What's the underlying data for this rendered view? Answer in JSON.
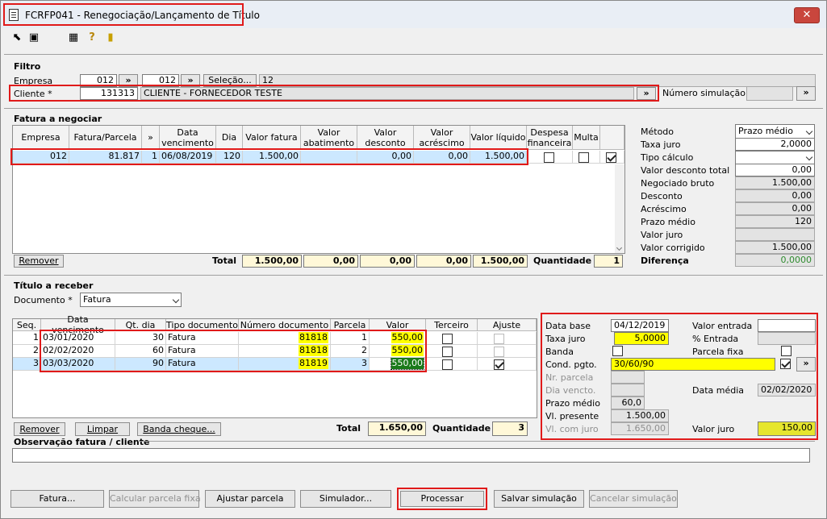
{
  "window": {
    "title": "FCRFP041 - Renegociação/Lançamento de Título",
    "close": "✕"
  },
  "toolbar": {
    "icons": [
      "cursor-arrow-icon",
      "copy-window-icon",
      "grid-icon",
      "help-icon",
      "exit-door-icon"
    ]
  },
  "filtro": {
    "legend": "Filtro",
    "empresa_label": "Empresa",
    "empresa_from": "012",
    "empresa_to": "012",
    "lookup": "»",
    "selecao_label": "Seleção...",
    "selecao_value": "12",
    "cliente_label": "Cliente *",
    "cliente_code": "131313",
    "cliente_name": "CLIENTE - FORNECEDOR TESTE",
    "numero_sim_label": "Número simulação",
    "numero_sim_value": ""
  },
  "fatura": {
    "legend": "Fatura a negociar",
    "headers": [
      "Empresa",
      "Fatura/Parcela",
      "»",
      "Data vencimento",
      "Dia",
      "Valor fatura",
      "Valor abatimento",
      "Valor desconto",
      "Valor acréscimo",
      "Valor líquido",
      "Despesa financeira",
      "Multa",
      ""
    ],
    "row": [
      "012",
      "81.817",
      "1",
      "06/08/2019",
      "120",
      "1.500,00",
      "",
      "0,00",
      "0,00",
      "1.500,00"
    ],
    "remover": "Remover",
    "total_label": "Total",
    "totals": [
      "1.500,00",
      "0,00",
      "0,00",
      "0,00",
      "1.500,00"
    ],
    "quantidade_label": "Quantidade",
    "quantidade": "1"
  },
  "metodo": {
    "metodo_label": "Método",
    "metodo_value": "Prazo médio",
    "taxa_juro_label": "Taxa juro",
    "taxa_juro": "2,0000",
    "tipo_calculo_label": "Tipo cálculo",
    "tipo_calculo": "",
    "valor_desc_total_label": "Valor desconto total",
    "valor_desc_total": "0,00",
    "negociado_bruto_label": "Negociado bruto",
    "negociado_bruto": "1.500,00",
    "desconto_label": "Desconto",
    "desconto": "0,00",
    "acrescimo_label": "Acréscimo",
    "acrescimo": "0,00",
    "prazo_medio_label": "Prazo médio",
    "prazo_medio": "120",
    "valor_juro_label": "Valor juro",
    "valor_juro": "",
    "valor_corrigido_label": "Valor corrigido",
    "valor_corrigido": "1.500,00",
    "diferenca_label": "Diferença",
    "diferenca": "0,0000"
  },
  "titulo": {
    "legend": "Título a receber",
    "documento_label": "Documento *",
    "documento": "Fatura",
    "headers": [
      "Seq.",
      "Data vencimento",
      "Qt. dia",
      "Tipo documento",
      "Número documento",
      "Parcela",
      "Valor",
      "Terceiro",
      "Ajuste"
    ],
    "rows": [
      {
        "seq": "1",
        "data": "03/01/2020",
        "dias": "30",
        "tipo": "Fatura",
        "numero": "81818",
        "parcela": "1",
        "valor": "550,00"
      },
      {
        "seq": "2",
        "data": "02/02/2020",
        "dias": "60",
        "tipo": "Fatura",
        "numero": "81818",
        "parcela": "2",
        "valor": "550,00"
      },
      {
        "seq": "3",
        "data": "03/03/2020",
        "dias": "90",
        "tipo": "Fatura",
        "numero": "81819",
        "parcela": "3",
        "valor": "550,00"
      }
    ],
    "remover": "Remover",
    "limpar": "Limpar",
    "banda_cheque": "Banda cheque...",
    "total_label": "Total",
    "total": "1.650,00",
    "quantidade_label": "Quantidade",
    "quantidade": "3"
  },
  "calc": {
    "data_base_label": "Data base",
    "data_base": "04/12/2019",
    "valor_entrada_label": "Valor entrada",
    "valor_entrada": "",
    "taxa_juro_label": "Taxa juro",
    "taxa_juro": "5,0000",
    "pct_entrada_label": "% Entrada",
    "pct_entrada": "",
    "banda_label": "Banda",
    "parcela_fixa_label": "Parcela fixa",
    "cond_pgto_label": "Cond. pgto.",
    "cond_pgto": "30/60/90",
    "nr_parcela_label": "Nr. parcela",
    "nr_parcela": "",
    "dia_vencto_label": "Dia vencto.",
    "dia_vencto": "",
    "data_media_label": "Data média",
    "data_media": "02/02/2020",
    "prazo_medio_label": "Prazo médio",
    "prazo_medio": "60,0",
    "vl_presente_label": "Vl. presente",
    "vl_presente": "1.500,00",
    "vl_com_juro_label": "Vl. com juro",
    "vl_com_juro": "1.650,00",
    "valor_juro_label": "Valor juro",
    "valor_juro": "150,00"
  },
  "observacao": {
    "label": "Observação fatura / cliente",
    "value": ""
  },
  "footer": {
    "fatura": "Fatura...",
    "calcular": "Calcular parcela fixa",
    "ajustar": "Ajustar parcela",
    "simulador": "Simulador...",
    "processar": "Processar",
    "salvar": "Salvar simulação",
    "cancelar": "Cancelar simulação"
  }
}
